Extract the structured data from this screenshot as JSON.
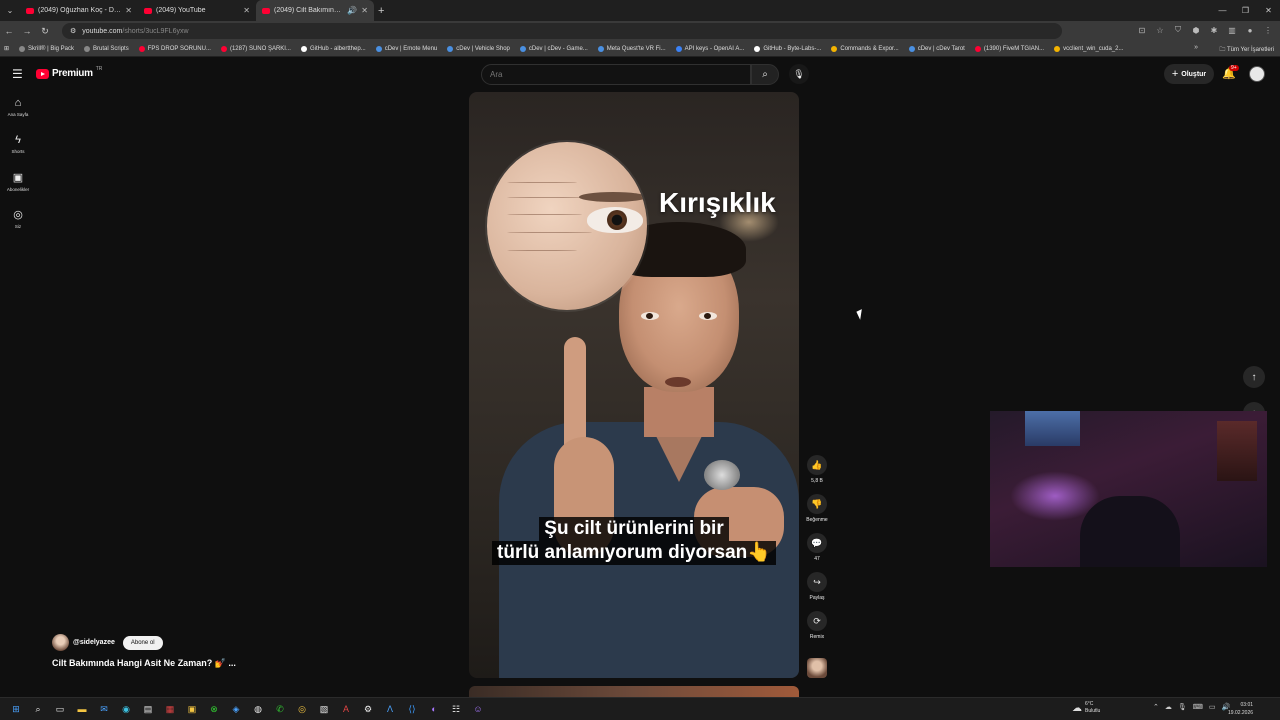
{
  "browser": {
    "tabs": [
      {
        "title": "(2049) Oğuzhan Koç - Domuz C...",
        "active": false
      },
      {
        "title": "(2049) YouTube",
        "active": false
      },
      {
        "title": "(2049) Cilt Bakımında Hang...",
        "active": true
      }
    ],
    "url_host": "youtube.com",
    "url_path": "/shorts/3ucL9FL6yxw",
    "bookmarks": [
      "Skrill® | Big Pack",
      "Brutal Scripts",
      "FPS DROP SORUNU...",
      "(1287) SUNO ŞARKI...",
      "GitHub - albertthep...",
      "cDev | Emote Menu",
      "cDev | Vehicle Shop",
      "cDev | cDev - Game...",
      "Meta Quest'te VR Fi...",
      "API keys - OpenAI A...",
      "GitHub - Byte-Labs-...",
      "Commands & Expor...",
      "cDev | cDev Tarot",
      "(1390) FiveM TGIAN...",
      "vcclient_win_cuda_2..."
    ],
    "bookmarks_all": "Tüm Yer İşaretleri"
  },
  "youtube": {
    "logo": "Premium",
    "logo_country": "TR",
    "search_placeholder": "Ara",
    "create_label": "Oluştur",
    "notif_count": "9+",
    "sidenav": [
      {
        "icon": "⌂",
        "label": "Ana Sayfa",
        "name": "home"
      },
      {
        "icon": "ϟ",
        "label": "Shorts",
        "name": "shorts"
      },
      {
        "icon": "▣",
        "label": "Abonelikler",
        "name": "subscriptions"
      },
      {
        "icon": "◎",
        "label": "Siz",
        "name": "you"
      }
    ],
    "video": {
      "overlay_title": "Kırışıklık",
      "subtitle_line1": "Şu cilt ürünlerini bir",
      "subtitle_line2": "türlü anlamıyorum diyorsan👆"
    },
    "actions": [
      {
        "icon": "👍",
        "label": "5,8 B",
        "name": "like"
      },
      {
        "icon": "👎",
        "label": "Beğenme",
        "name": "dislike"
      },
      {
        "icon": "💬",
        "label": "47",
        "name": "comments"
      },
      {
        "icon": "↪",
        "label": "Paylaş",
        "name": "share"
      },
      {
        "icon": "⟳",
        "label": "Remix",
        "name": "remix"
      }
    ],
    "channel": {
      "handle": "@sidelyazee",
      "subscribe_label": "Abone ol"
    },
    "video_title": "Cilt Bakımında Hangi Asit Ne Zaman? 💅 ..."
  },
  "taskbar": {
    "weather_temp": "6°C",
    "weather_desc": "Bulutlu",
    "time": "03:01",
    "date": "19.02.2026"
  }
}
